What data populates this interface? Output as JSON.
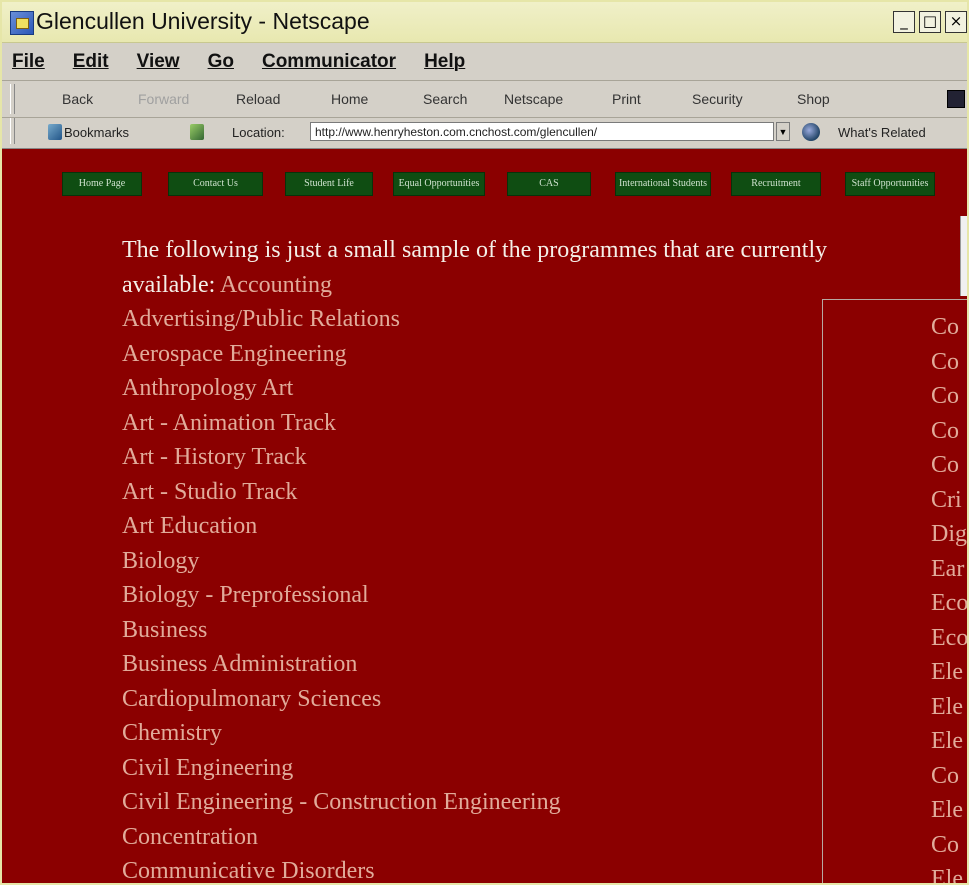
{
  "window": {
    "title": "Glencullen University - Netscape",
    "min": "_",
    "max": "□",
    "close": "×"
  },
  "menu": [
    "File",
    "Edit",
    "View",
    "Go",
    "Communicator",
    "Help"
  ],
  "navbar": [
    "Back",
    "Forward",
    "Reload",
    "Home",
    "Search",
    "Netscape",
    "Print",
    "Security",
    "Shop"
  ],
  "location": {
    "bookmarks_label": "Bookmarks",
    "location_label": "Location:",
    "url": "http://www.henryheston.com.cnchost.com/glencullen/",
    "related_label": "What's Related"
  },
  "site_nav": [
    "Home Page",
    "Contact Us",
    "Student Life",
    "Equal Opportunities",
    "CAS",
    "International Students",
    "Recruitment",
    "Staff Opportunities"
  ],
  "main": {
    "intro": "The following is just a small sample of the programmes that are currently available:",
    "programs": [
      "Accounting",
      "Advertising/Public Relations",
      "Aerospace Engineering",
      "Anthropology Art",
      "Art - Animation Track",
      "Art - History Track",
      "Art - Studio Track",
      "Art Education",
      "Biology",
      "Biology - Preprofessional",
      "Business",
      "Business Administration",
      "Cardiopulmonary Sciences",
      "Chemistry",
      "Civil Engineering",
      "Civil Engineering - Construction Engineering",
      "Concentration",
      "Communicative Disorders"
    ]
  },
  "side_panel": [
    "Co",
    "Co",
    "Co",
    "Co",
    "Co",
    "Cri",
    "Dig",
    "Ear",
    "Eco",
    "Eco",
    "Ele",
    "Ele",
    "Ele",
    "Co",
    "Ele",
    "Co",
    "Ele"
  ]
}
